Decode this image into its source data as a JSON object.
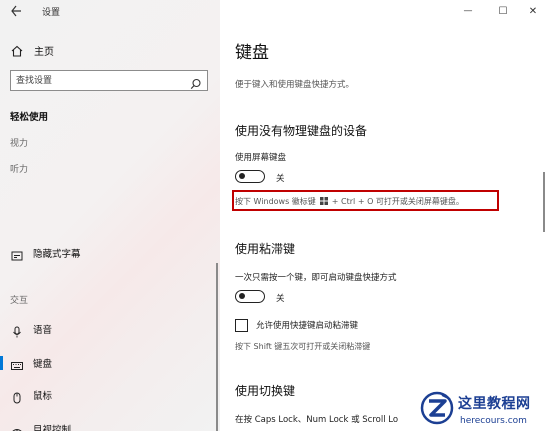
{
  "window": {
    "title": "设置",
    "minimize": "—",
    "maximize": "☐",
    "close": "✕"
  },
  "sidebar": {
    "home_label": "主页",
    "search_placeholder": "查找设置",
    "section_title": "轻松使用",
    "categories": {
      "vision": "视力",
      "hearing": "听力",
      "interaction": "交互"
    },
    "items": [
      {
        "label": "隐藏式字幕",
        "icon": "closed-caption-icon"
      },
      {
        "label": "语音",
        "icon": "microphone-icon"
      },
      {
        "label": "键盘",
        "icon": "keyboard-icon",
        "selected": true
      },
      {
        "label": "鼠标",
        "icon": "mouse-icon"
      },
      {
        "label": "目视控制",
        "icon": "eye-control-icon"
      }
    ]
  },
  "main": {
    "title": "键盘",
    "description": "便于键入和使用键盘快捷方式。",
    "osk": {
      "heading": "使用没有物理键盘的设备",
      "toggle_label": "使用屏幕键盘",
      "toggle_state": "关",
      "hint_prefix": "按下 Windows 徽标键",
      "hint_suffix": "+ Ctrl + O 可打开或关闭屏幕键盘。"
    },
    "sticky": {
      "heading": "使用粘滞键",
      "toggle_label": "一次只需按一个键，即可启动键盘快捷方式",
      "toggle_state": "关",
      "checkbox_label": "允许使用快捷键启动粘滞键",
      "hint": "按下 Shift 键五次可打开或关闭粘滞键"
    },
    "toggle_keys": {
      "heading": "使用切换键",
      "description": "在按 Caps Lock、Num Lock 或 Scroll Lo"
    }
  },
  "watermark": {
    "name": "这里教程网",
    "url": "herecours.com"
  },
  "colors": {
    "accent": "#0078d7",
    "highlight": "#c00000",
    "watermark": "#1c3f93"
  }
}
